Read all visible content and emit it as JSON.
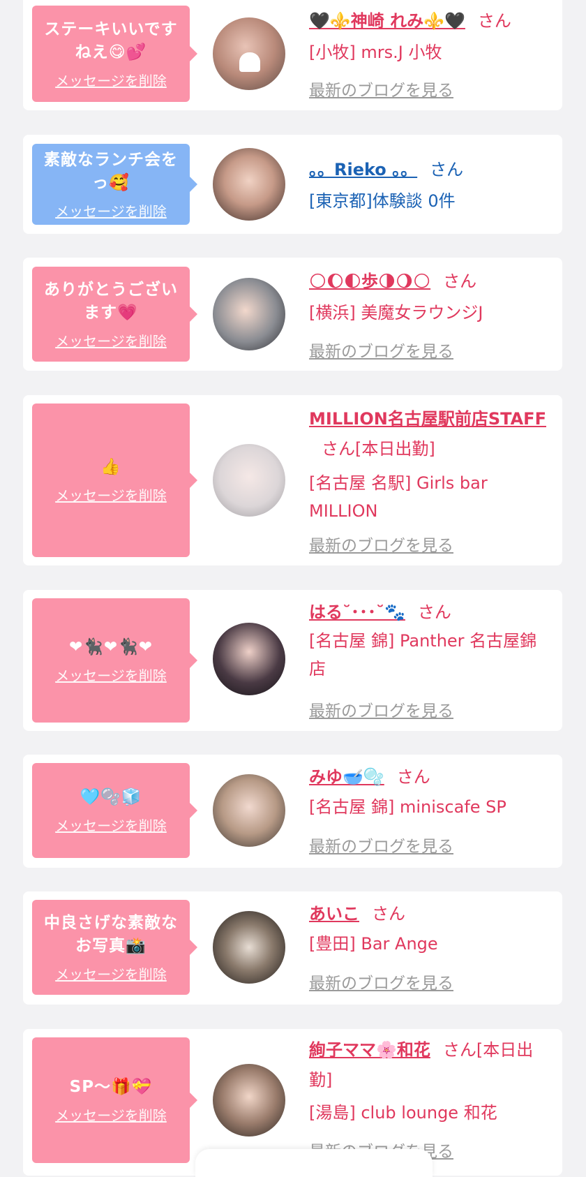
{
  "cards": [
    {
      "message": "ステーキいいですねえ😋💕",
      "delete": "メッセージを削除",
      "name": "🖤⚜️神崎 れみ⚜️🖤",
      "san": "さん",
      "status": "",
      "shop": "[小牧] mrs.J 小牧",
      "blog": "最新のブログを見る",
      "color": "pink"
    },
    {
      "message": "素敵なランチ会をっ🥰",
      "delete": "メッセージを削除",
      "name": "。。Rieko 。。",
      "san": "さん",
      "status": "",
      "shop": "[東京都]体験談 0件",
      "blog": "",
      "color": "blue"
    },
    {
      "message": "ありがとうございます💗",
      "delete": "メッセージを削除",
      "name": "🌕🌔🌓歩🌗🌖🌕",
      "san": "さん",
      "status": "",
      "shop": "[横浜] 美魔女ラウンジJ",
      "blog": "最新のブログを見る",
      "color": "pink"
    },
    {
      "message": "👍",
      "delete": "メッセージを削除",
      "name": "MILLION名古屋駅前店STAFF",
      "san": "さん",
      "status": "[本日出勤]",
      "shop": "[名古屋 名駅] Girls bar MILLION",
      "blog": "最新のブログを見る",
      "color": "pink"
    },
    {
      "message": "❤🐈‍⬛❤🐈‍⬛❤",
      "delete": "メッセージを削除",
      "name": "はる˘･･･˘🐾",
      "san": "さん",
      "status": "",
      "shop": "[名古屋 錦] Panther 名古屋錦店",
      "blog": "最新のブログを見る",
      "color": "pink"
    },
    {
      "message": "🩵🫧🧊",
      "delete": "メッセージを削除",
      "name": "みゆ🥣🫧",
      "san": "さん",
      "status": "",
      "shop": "[名古屋 錦] miniscafe SP",
      "blog": "最新のブログを見る",
      "color": "pink"
    },
    {
      "message": "中良さげな素敵なお写真📸",
      "delete": "メッセージを削除",
      "name": "あいこ",
      "san": "さん",
      "status": "",
      "shop": "[豊田] Bar Ange",
      "blog": "最新のブログを見る",
      "color": "pink"
    },
    {
      "message": "SP〜🎁💝",
      "delete": "メッセージを削除",
      "name": "絢子ママ🌸和花",
      "san": "さん",
      "status": "[本日出勤]",
      "shop": "[湯島] club lounge 和花",
      "blog": "最新のブログを見る",
      "color": "pink"
    }
  ],
  "colors": {
    "bubble_pink": "#fb93a9",
    "bubble_blue": "#86b5f5",
    "name_pink": "#e0385d",
    "name_blue": "#1b62b4",
    "link_gray": "#9a9a9a"
  }
}
